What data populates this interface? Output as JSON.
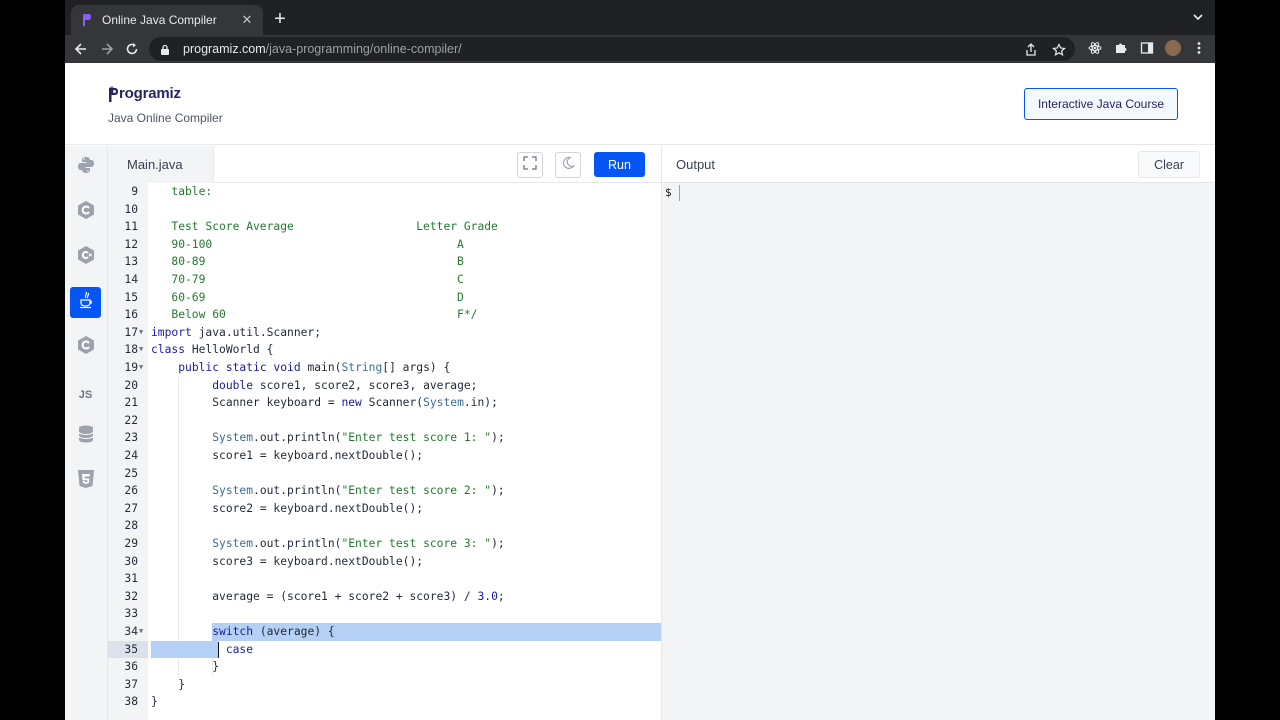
{
  "browser": {
    "tab_title": "Online Java Compiler",
    "url_host": "programiz.com",
    "url_path": "/java-programming/online-compiler/"
  },
  "header": {
    "logo_text": "rogramiz",
    "subtitle": "Java Online Compiler",
    "course_button": "Interactive Java Course"
  },
  "sidebar": {
    "languages": [
      {
        "name": "python",
        "icon": "python-icon"
      },
      {
        "name": "c",
        "icon": "c-icon"
      },
      {
        "name": "csharp",
        "icon": "csharp-icon"
      },
      {
        "name": "java",
        "icon": "java-icon",
        "active": true
      },
      {
        "name": "cpp",
        "icon": "cpp-icon"
      },
      {
        "name": "javascript",
        "label": "JS"
      },
      {
        "name": "sql",
        "icon": "database-icon"
      },
      {
        "name": "html",
        "icon": "html5-icon"
      }
    ]
  },
  "editor": {
    "file_name": "Main.java",
    "run_label": "Run",
    "active_line": 35,
    "lines": [
      {
        "n": "9",
        "segs": [
          [
            "comment",
            "table:"
          ]
        ]
      },
      {
        "n": "10",
        "segs": []
      },
      {
        "n": "11",
        "segs": [
          [
            "comment",
            "Test Score Average                  Letter Grade"
          ]
        ]
      },
      {
        "n": "12",
        "segs": [
          [
            "comment",
            "90-100                                    A"
          ]
        ]
      },
      {
        "n": "13",
        "segs": [
          [
            "comment",
            "80-89                                     B"
          ]
        ]
      },
      {
        "n": "14",
        "segs": [
          [
            "comment",
            "70-79                                     C"
          ]
        ]
      },
      {
        "n": "15",
        "segs": [
          [
            "comment",
            "60-69                                     D"
          ]
        ]
      },
      {
        "n": "16",
        "segs": [
          [
            "comment",
            "Below 60                                  F*/"
          ]
        ]
      },
      {
        "n": "17",
        "fold": true,
        "segs": [
          [
            "kw",
            "import"
          ],
          [
            "",
            " java.util.Scanner;"
          ]
        ]
      },
      {
        "n": "18",
        "fold": true,
        "segs": [
          [
            "kw",
            "class"
          ],
          [
            "",
            " HelloWorld {"
          ]
        ]
      },
      {
        "n": "19",
        "fold": true,
        "segs": [
          [
            "",
            "    "
          ],
          [
            "kw",
            "public static void"
          ],
          [
            "",
            " main("
          ],
          [
            "cls",
            "String"
          ],
          [
            "",
            "[] args) {"
          ]
        ]
      },
      {
        "n": "20",
        "segs": [
          [
            "",
            "         "
          ],
          [
            "kw",
            "double"
          ],
          [
            "",
            " score1, score2, score3, average;"
          ]
        ]
      },
      {
        "n": "21",
        "segs": [
          [
            "",
            "         Scanner keyboard = "
          ],
          [
            "kw",
            "new"
          ],
          [
            "",
            " Scanner("
          ],
          [
            "cls",
            "System"
          ],
          [
            "",
            ".in);"
          ]
        ]
      },
      {
        "n": "22",
        "segs": []
      },
      {
        "n": "23",
        "segs": [
          [
            "",
            "         "
          ],
          [
            "cls",
            "System"
          ],
          [
            "",
            ".out.println("
          ],
          [
            "str",
            "\"Enter test score 1: \""
          ],
          [
            "",
            ");"
          ]
        ]
      },
      {
        "n": "24",
        "segs": [
          [
            "",
            "         score1 = keyboard.nextDouble();"
          ]
        ]
      },
      {
        "n": "25",
        "segs": []
      },
      {
        "n": "26",
        "segs": [
          [
            "",
            "         "
          ],
          [
            "cls",
            "System"
          ],
          [
            "",
            ".out.println("
          ],
          [
            "str",
            "\"Enter test score 2: \""
          ],
          [
            "",
            ");"
          ]
        ]
      },
      {
        "n": "27",
        "segs": [
          [
            "",
            "         score2 = keyboard.nextDouble();"
          ]
        ]
      },
      {
        "n": "28",
        "segs": []
      },
      {
        "n": "29",
        "segs": [
          [
            "",
            "         "
          ],
          [
            "cls",
            "System"
          ],
          [
            "",
            ".out.println("
          ],
          [
            "str",
            "\"Enter test score 3: \""
          ],
          [
            "",
            ");"
          ]
        ]
      },
      {
        "n": "30",
        "segs": [
          [
            "",
            "         score3 = keyboard.nextDouble();"
          ]
        ]
      },
      {
        "n": "31",
        "segs": []
      },
      {
        "n": "32",
        "segs": [
          [
            "",
            "         average = (score1 + score2 + score3) / "
          ],
          [
            "num",
            "3.0"
          ],
          [
            "",
            ";"
          ]
        ]
      },
      {
        "n": "33",
        "segs": []
      },
      {
        "n": "34",
        "fold": true,
        "segs": [
          [
            "",
            "         "
          ],
          [
            "kw",
            "switch"
          ],
          [
            "",
            " (average) {"
          ]
        ]
      },
      {
        "n": "35",
        "segs": [
          [
            "",
            "           "
          ],
          [
            "kw",
            "case"
          ]
        ]
      },
      {
        "n": "36",
        "segs": [
          [
            "",
            "         }"
          ]
        ]
      },
      {
        "n": "37",
        "segs": [
          [
            "",
            "    }"
          ]
        ]
      },
      {
        "n": "38",
        "segs": [
          [
            "",
            "}"
          ]
        ]
      }
    ]
  },
  "output": {
    "title": "Output",
    "clear_label": "Clear",
    "prompt": "$"
  },
  "colors": {
    "accent": "#0556f3",
    "logo": "#25265e",
    "selection": "#b5d0f5"
  }
}
